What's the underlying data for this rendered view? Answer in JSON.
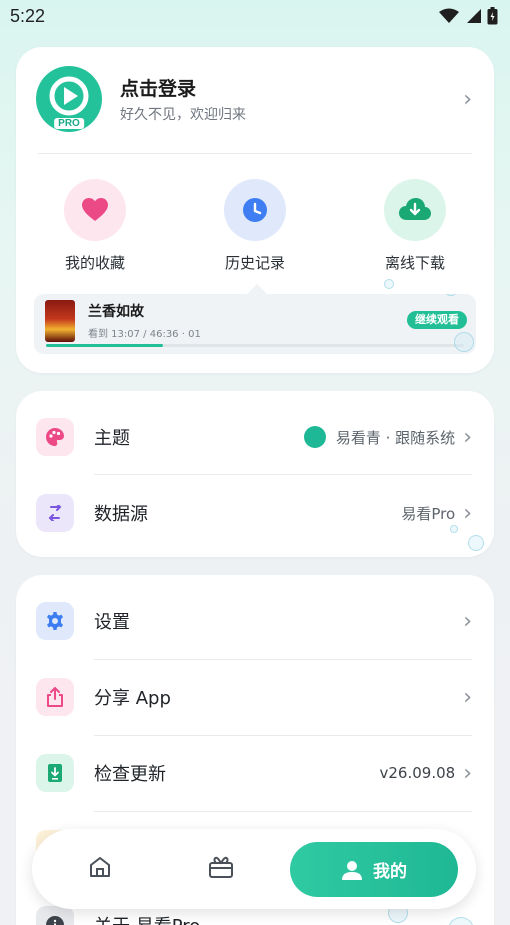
{
  "status_bar": {
    "time": "5:22"
  },
  "profile": {
    "badge": "PRO",
    "title": "点击登录",
    "subtitle": "好久不见，欢迎归来"
  },
  "quick_actions": [
    {
      "label": "我的收藏",
      "icon": "heart-icon",
      "bg": "#fde6ee",
      "color": "#ec4a86"
    },
    {
      "label": "历史记录",
      "icon": "clock-icon",
      "bg": "#dfe9fb",
      "color": "#3e7ef2"
    },
    {
      "label": "离线下载",
      "icon": "cloud-download-icon",
      "bg": "#dcf5ea",
      "color": "#1aa874"
    }
  ],
  "recent_watch": {
    "title": "兰香如故",
    "progress_text": "看到 13:07 / 46:36 · 01",
    "progress_fraction": 0.28,
    "continue_label": "继续观看"
  },
  "theme_section": {
    "theme_label": "主题",
    "theme_value": "易看青 · 跟随系统",
    "theme_color": "#1eb896",
    "source_label": "数据源",
    "source_value": "易看Pro"
  },
  "settings_section": {
    "settings_label": "设置",
    "share_label": "分享 App",
    "update_label": "检查更新",
    "update_value": "v26.09.08",
    "about_label": "关于 易看Pro"
  },
  "bottom_nav": {
    "home_icon": "home-icon",
    "discover_icon": "gift-icon",
    "mine_label": "我的",
    "accent": "#22bf97"
  }
}
